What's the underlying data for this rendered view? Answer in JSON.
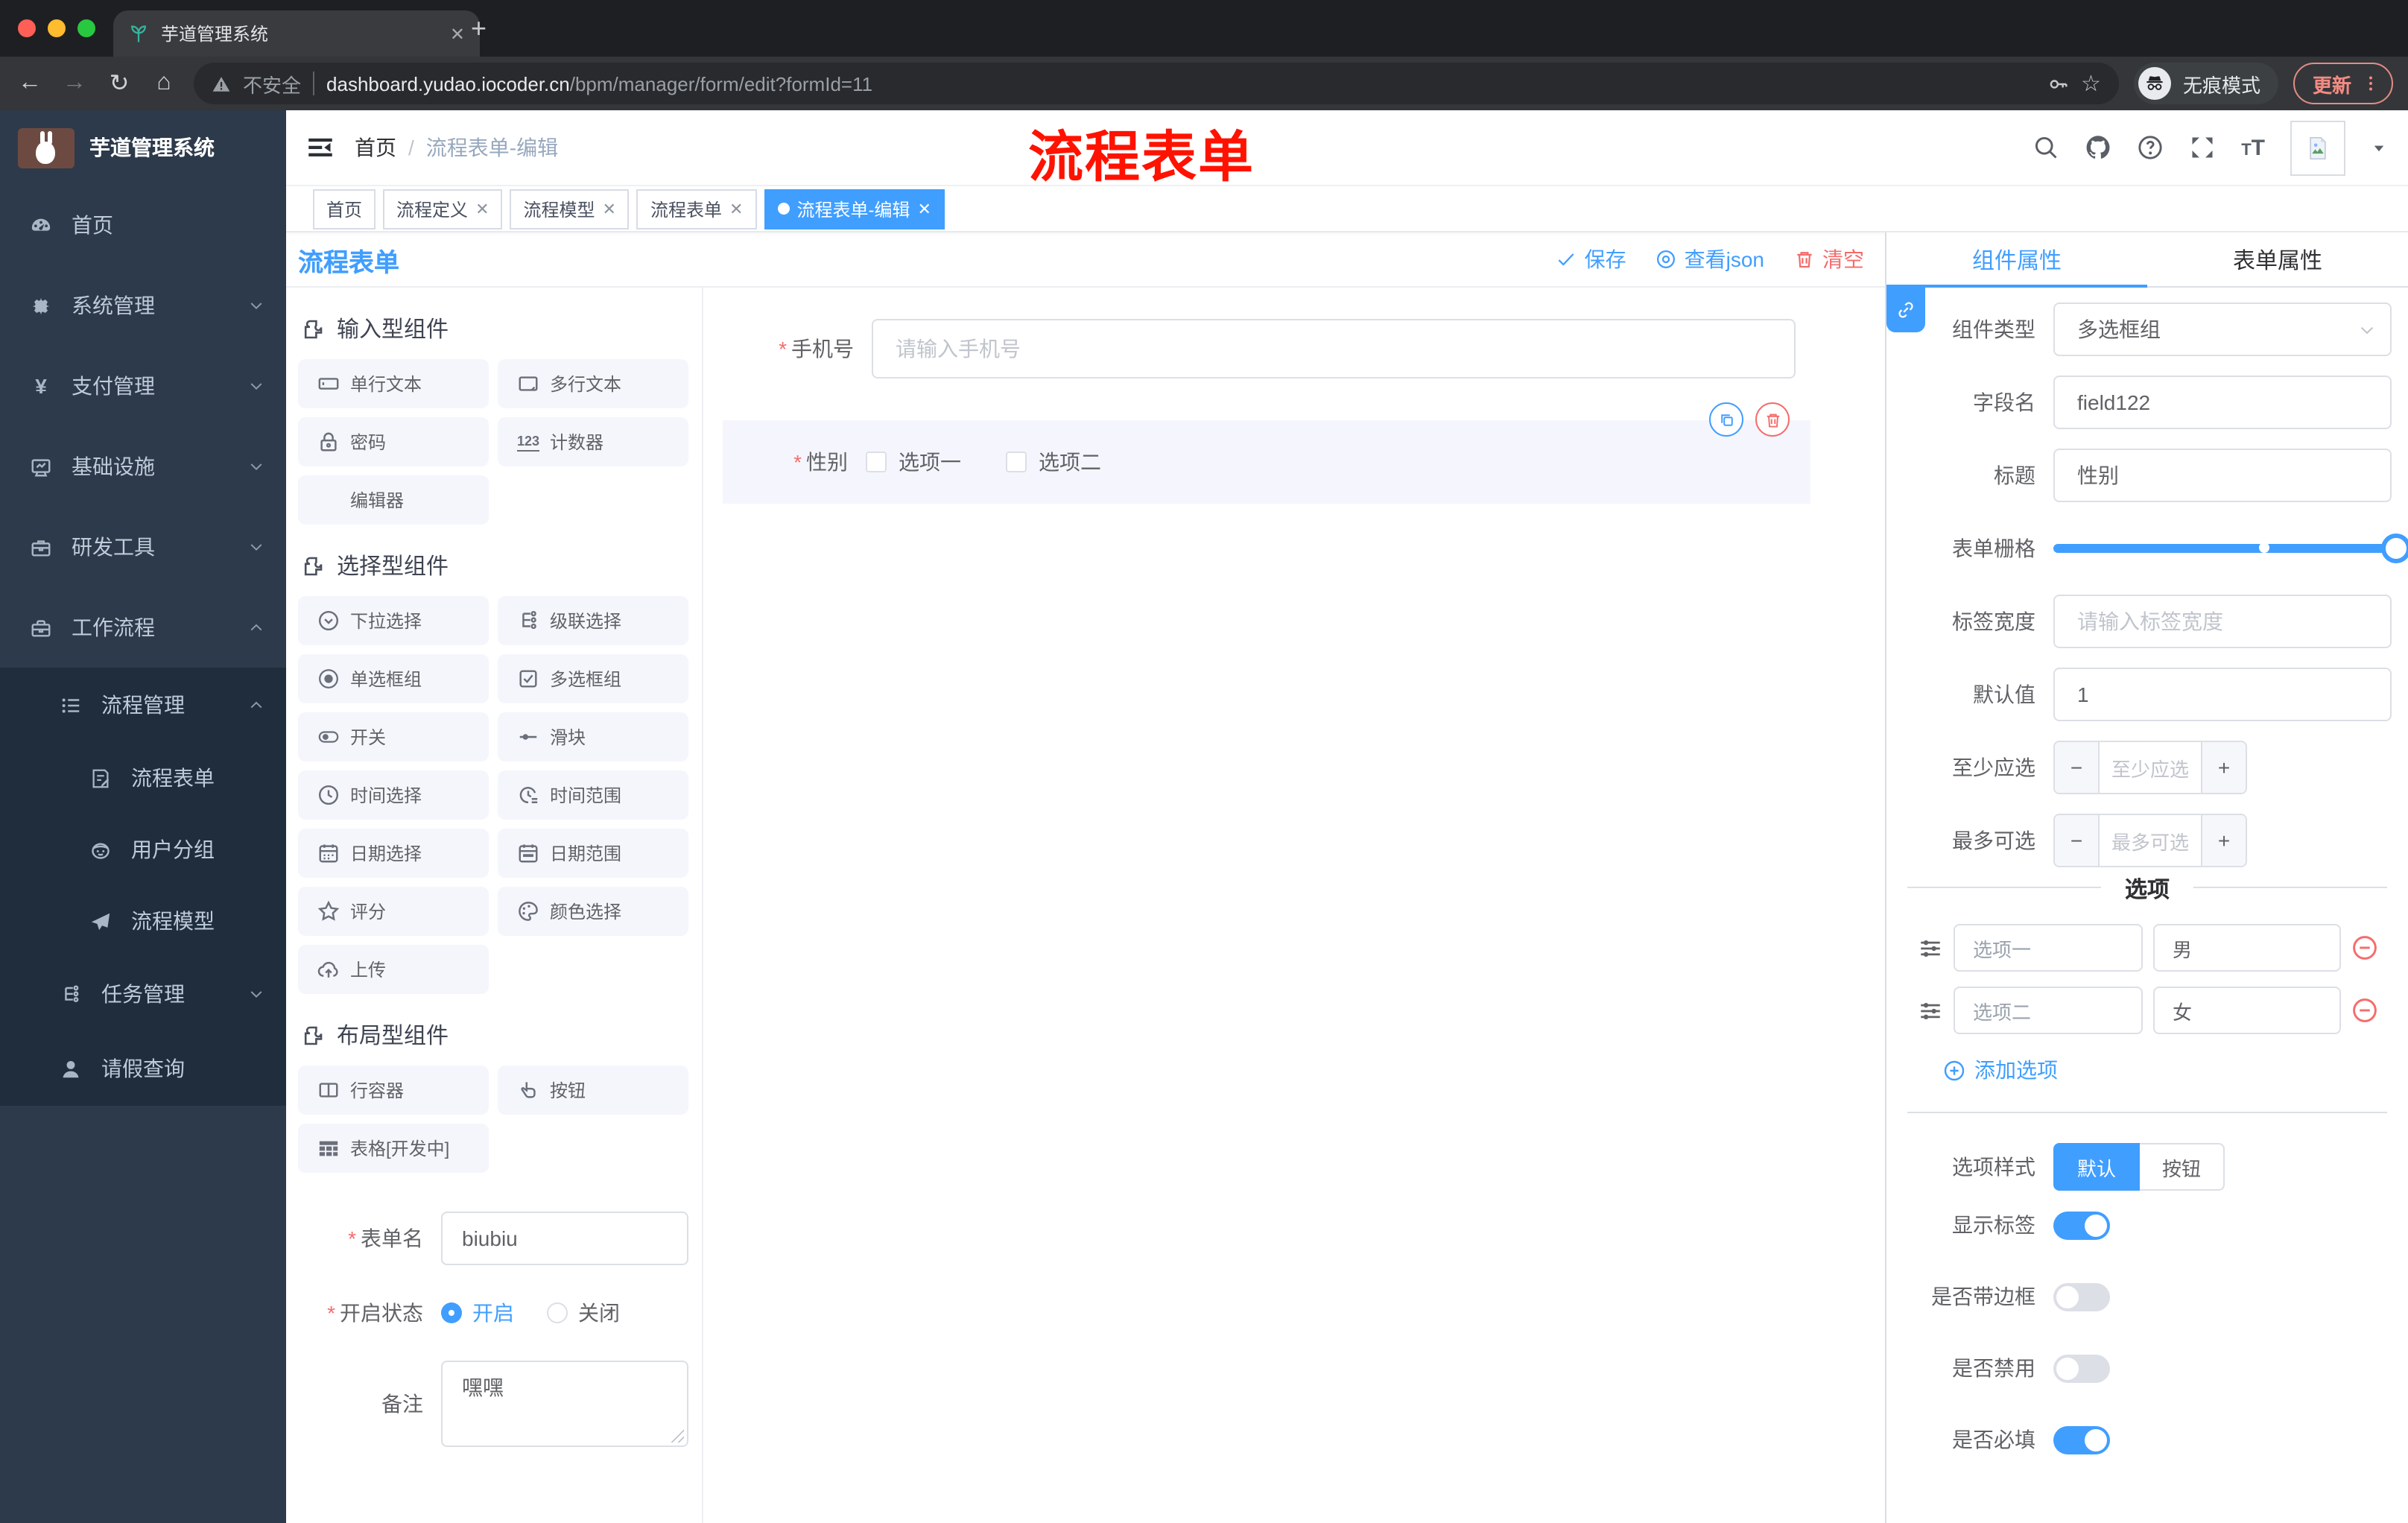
{
  "browser": {
    "tab_title": "芋道管理系统",
    "url_security": "不安全",
    "url_host": "dashboard.yudao.iocoder.cn",
    "url_path": "/bpm/manager/form/edit?formId=11",
    "incognito_label": "无痕模式",
    "update_label": "更新"
  },
  "sidebar": {
    "logo_title": "芋道管理系统",
    "items": [
      {
        "label": "首页",
        "icon": "gauge",
        "level": 1,
        "chevron": "",
        "sub": false
      },
      {
        "label": "系统管理",
        "icon": "gear",
        "level": 1,
        "chevron": "down",
        "sub": false
      },
      {
        "label": "支付管理",
        "icon": "yen",
        "level": 1,
        "chevron": "down",
        "sub": false
      },
      {
        "label": "基础设施",
        "icon": "monitor",
        "level": 1,
        "chevron": "down",
        "sub": false
      },
      {
        "label": "研发工具",
        "icon": "briefcase",
        "level": 1,
        "chevron": "down",
        "sub": false
      },
      {
        "label": "工作流程",
        "icon": "toolbox",
        "level": 1,
        "chevron": "up",
        "sub": false
      },
      {
        "label": "流程管理",
        "icon": "stream",
        "level": 2,
        "chevron": "up",
        "sub": true
      },
      {
        "label": "流程表单",
        "icon": "form-doc",
        "level": 3,
        "chevron": "",
        "sub": true
      },
      {
        "label": "用户分组",
        "icon": "robot",
        "level": 3,
        "chevron": "",
        "sub": true
      },
      {
        "label": "流程模型",
        "icon": "send",
        "level": 3,
        "chevron": "",
        "sub": true
      },
      {
        "label": "任务管理",
        "icon": "tree",
        "level": 2,
        "chevron": "down",
        "sub": true
      },
      {
        "label": "请假查询",
        "icon": "user",
        "level": 2,
        "chevron": "",
        "sub": true
      }
    ]
  },
  "navbar": {
    "breadcrumb_home": "首页",
    "breadcrumb_current": "流程表单-编辑",
    "overlay_note": "流程表单"
  },
  "tags": [
    {
      "label": "首页",
      "closable": false,
      "active": false
    },
    {
      "label": "流程定义",
      "closable": true,
      "active": false
    },
    {
      "label": "流程模型",
      "closable": true,
      "active": false
    },
    {
      "label": "流程表单",
      "closable": true,
      "active": false
    },
    {
      "label": "流程表单-编辑",
      "closable": true,
      "active": true
    }
  ],
  "designer": {
    "title": "流程表单",
    "save_label": "保存",
    "view_json_label": "查看json",
    "clear_label": "清空"
  },
  "palette": {
    "sections": [
      {
        "title": "输入型组件",
        "items": [
          {
            "label": "单行文本",
            "icon": "input"
          },
          {
            "label": "多行文本",
            "icon": "textarea"
          },
          {
            "label": "密码",
            "icon": "lock"
          },
          {
            "label": "计数器",
            "icon": "counter"
          },
          {
            "label": "编辑器",
            "icon": "none"
          }
        ]
      },
      {
        "title": "选择型组件",
        "items": [
          {
            "label": "下拉选择",
            "icon": "select"
          },
          {
            "label": "级联选择",
            "icon": "cascade"
          },
          {
            "label": "单选框组",
            "icon": "radio"
          },
          {
            "label": "多选框组",
            "icon": "checkbox"
          },
          {
            "label": "开关",
            "icon": "switch"
          },
          {
            "label": "滑块",
            "icon": "slider"
          },
          {
            "label": "时间选择",
            "icon": "time"
          },
          {
            "label": "时间范围",
            "icon": "time-range"
          },
          {
            "label": "日期选择",
            "icon": "date"
          },
          {
            "label": "日期范围",
            "icon": "date-range"
          },
          {
            "label": "评分",
            "icon": "rate"
          },
          {
            "label": "颜色选择",
            "icon": "color"
          },
          {
            "label": "上传",
            "icon": "upload"
          }
        ]
      },
      {
        "title": "布局型组件",
        "items": [
          {
            "label": "行容器",
            "icon": "row"
          },
          {
            "label": "按钮",
            "icon": "button"
          },
          {
            "label": "表格[开发中]",
            "icon": "table"
          }
        ]
      }
    ],
    "form": {
      "name_label": "表单名",
      "name_value": "biubiu",
      "status_label": "开启状态",
      "status_on": "开启",
      "status_off": "关闭",
      "remark_label": "备注",
      "remark_value": "嘿嘿"
    }
  },
  "canvas": {
    "phone_label": "手机号",
    "phone_placeholder": "请输入手机号",
    "gender_label": "性别",
    "gender_options": [
      "选项一",
      "选项二"
    ]
  },
  "panel": {
    "tab_component": "组件属性",
    "tab_form": "表单属性",
    "rows": {
      "type_label": "组件类型",
      "type_value": "多选框组",
      "field_label": "字段名",
      "field_value": "field122",
      "title_label": "标题",
      "title_value": "性别",
      "grid_label": "表单栅格",
      "label_width_label": "标签宽度",
      "label_width_placeholder": "请输入标签宽度",
      "default_label": "默认值",
      "default_value": "1",
      "min_label": "至少应选",
      "min_placeholder": "至少应选",
      "max_label": "最多可选",
      "max_placeholder": "最多可选"
    },
    "options": {
      "title": "选项",
      "rows": [
        {
          "label": "选项一",
          "value": "男"
        },
        {
          "label": "选项二",
          "value": "女"
        }
      ],
      "add_label": "添加选项"
    },
    "style": {
      "label": "选项样式",
      "on": "默认",
      "off": "按钮"
    },
    "switches": [
      {
        "label": "显示标签",
        "on": true
      },
      {
        "label": "是否带边框",
        "on": false
      },
      {
        "label": "是否禁用",
        "on": false
      },
      {
        "label": "是否必填",
        "on": true
      }
    ]
  },
  "colors": {
    "accent": "#409eff",
    "danger": "#f56c6c",
    "note_red": "#ff1200",
    "sidebar_bg": "#2d3a4b",
    "submenu_bg": "#1f2d3d",
    "active_tag_bg": "#409eff"
  }
}
